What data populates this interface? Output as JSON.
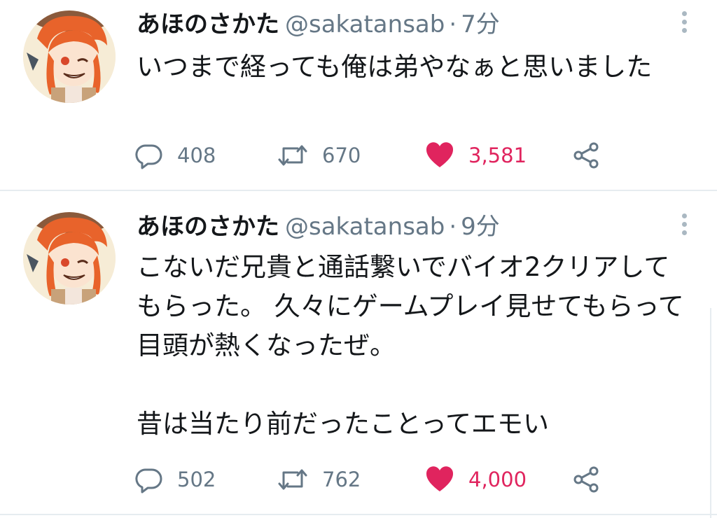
{
  "tweets": [
    {
      "display_name": "あほのさかた",
      "handle": "@sakatansab",
      "separator": "·",
      "time": "7分",
      "text": "いつまで経っても俺は弟やなぁと思いました",
      "counts": {
        "reply": "408",
        "retweet": "670",
        "like": "3,581"
      },
      "liked": true
    },
    {
      "display_name": "あほのさかた",
      "handle": "@sakatansab",
      "separator": "·",
      "time": "9分",
      "text": "こないだ兄貴と通話繋いでバイオ2クリアしてもらった。 久々にゲームプレイ見せてもらって目頭が熱くなったぜ。\n\n昔は当たり前だったことってエモい",
      "counts": {
        "reply": "502",
        "retweet": "762",
        "like": "4,000"
      },
      "liked": true
    }
  ],
  "icons": {
    "reply": "reply-bubble-icon",
    "retweet": "retweet-arrows-icon",
    "like": "heart-icon",
    "share": "share-icon",
    "more": "more-vertical-icon"
  },
  "colors": {
    "name": "#14171a",
    "secondary": "#657786",
    "like": "#e0245e",
    "divider": "#e6ecf0",
    "avatar_hair": "#e8632b",
    "avatar_bg": "#f6ecd6"
  }
}
